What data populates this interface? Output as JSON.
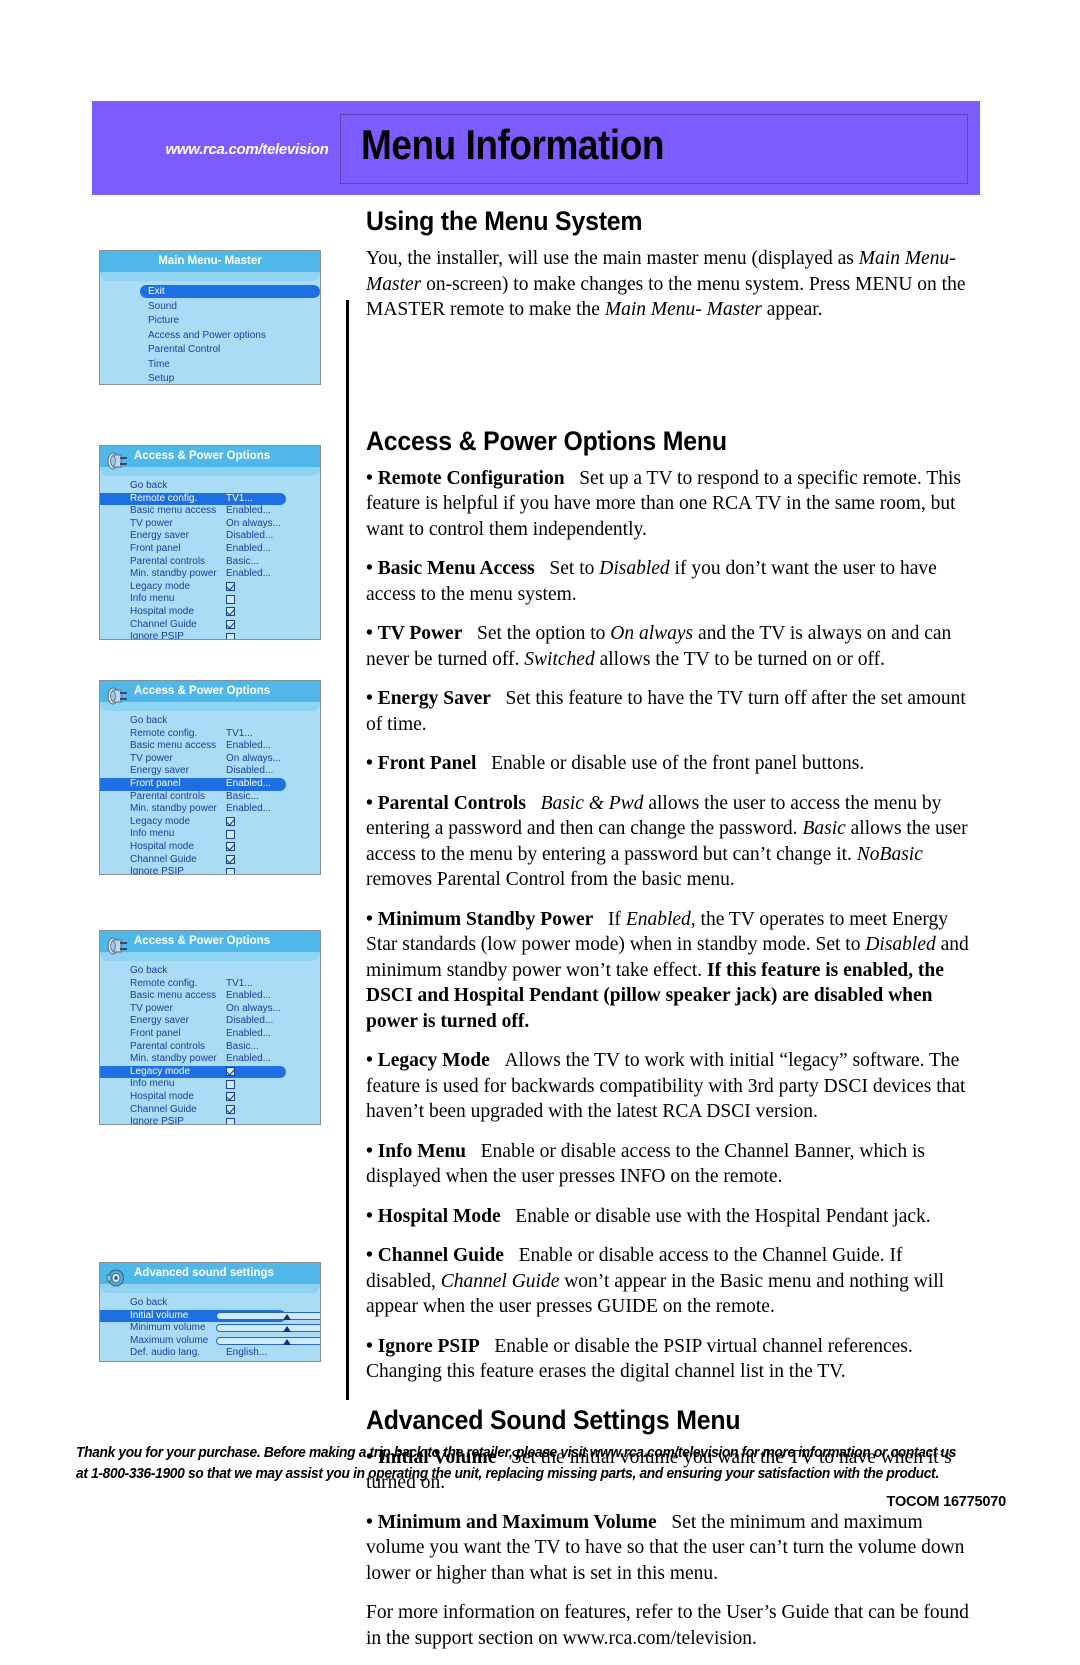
{
  "header": {
    "url": "www.rca.com/television",
    "title": "Menu Information"
  },
  "sections": {
    "using_menu": {
      "heading": "Using the Menu System",
      "p1_a": "You, the installer, will use the main master menu (displayed as ",
      "p1_i1": "Main Menu- Master",
      "p1_b": " on-screen) to make changes to the menu system. Press MENU on the MASTER remote to make the ",
      "p1_i2": "Main Menu- Master",
      "p1_c": " appear."
    },
    "access_power": {
      "heading": "Access & Power Options Menu",
      "b1_lead": "Remote Configuration",
      "b1_text": "Set up a TV to respond to a specific remote. This feature is helpful if you have more than one RCA TV in the same room, but want to control them independently.",
      "b2_lead": "Basic Menu Access",
      "b2_a": "Set to ",
      "b2_i1": "Disabled",
      "b2_b": " if you don’t want the user to have access to the menu system.",
      "b3_lead": "TV Power",
      "b3_a": "Set the option to ",
      "b3_i1": "On always",
      "b3_b": " and the TV is always on and can never be turned off. ",
      "b3_i2": "Switched",
      "b3_c": " allows the TV to be turned on or off.",
      "b4_lead": "Energy Saver",
      "b4_text": "Set this feature to have the TV turn off after the set amount of time.",
      "b5_lead": "Front Panel",
      "b5_text": "Enable or disable use of the front panel buttons.",
      "b6_lead": "Parental Controls",
      "b6_i1": "Basic & Pwd",
      "b6_a": " allows the user to access the menu by entering a password and then can change the password. ",
      "b6_i2": "Basic",
      "b6_b": " allows the user access to the menu by entering a password but can’t change it. ",
      "b6_i3": "NoBasic",
      "b6_c": " removes Parental Control from the basic menu.",
      "b7_lead": "Minimum Standby Power",
      "b7_a": "If ",
      "b7_i1": "Enabled",
      "b7_b": ", the TV operates to meet Energy Star standards (low power mode) when in standby mode. Set to ",
      "b7_i2": "Disabled",
      "b7_c": " and minimum standby power won’t take effect. ",
      "b7_bold": "If this feature is enabled, the DSCI and Hospital Pendant (pillow speaker jack) are disabled when power is turned off.",
      "b8_lead": "Legacy Mode",
      "b8_text": "Allows the TV to work with initial “legacy” software. The feature is used for backwards compatibility with 3rd party DSCI devices that haven’t been upgraded with the latest RCA DSCI version.",
      "b9_lead": "Info Menu",
      "b9_text": "Enable or disable access to the Channel Banner, which is displayed when the user presses INFO on the remote.",
      "b10_lead": "Hospital Mode",
      "b10_text": "Enable or disable use with the Hospital Pendant jack.",
      "b11_lead": "Channel Guide",
      "b11_a": "Enable or disable access to the Channel Guide. If disabled, ",
      "b11_i1": "Channel Guide",
      "b11_b": " won’t appear in the Basic menu and nothing will appear when the user presses GUIDE on the remote.",
      "b12_lead": "Ignore PSIP",
      "b12_text": "Enable or disable the PSIP virtual channel references. Changing this feature erases the digital channel list in the TV."
    },
    "advanced_sound": {
      "heading": "Advanced Sound Settings Menu",
      "b1_lead": "Initial Volume",
      "b1_text": "Set the initial volume you want the TV to have when it’s turned on.",
      "b2_lead": "Minimum and Maximum Volume",
      "b2_text": "Set the minimum and maximum volume you want the TV to have so that the user can’t turn the volume down lower or higher than what is set in this menu.",
      "closing": "For more information on features, refer to the User’s Guide that can be found in the support section on www.rca.com/television."
    }
  },
  "tv_menus": {
    "main": {
      "title": "Main Menu- Master",
      "items": [
        {
          "label": "Exit",
          "value": "",
          "selected": true
        },
        {
          "label": "Sound",
          "value": "",
          "selected": false
        },
        {
          "label": "Picture",
          "value": "",
          "selected": false
        },
        {
          "label": "Access and Power options",
          "value": "",
          "selected": false
        },
        {
          "label": "Parental Control",
          "value": "",
          "selected": false
        },
        {
          "label": "Time",
          "value": "",
          "selected": false
        },
        {
          "label": "Setup",
          "value": "",
          "selected": false
        }
      ]
    },
    "access_1": {
      "title": "Access & Power Options",
      "icon": "power-plug-icon",
      "selected_item": "Remote config.",
      "items": [
        {
          "label": "Go back",
          "value": "",
          "type": "plain"
        },
        {
          "label": "Remote config.",
          "value": "TV1...",
          "type": "value"
        },
        {
          "label": "Basic menu access",
          "value": "Enabled...",
          "type": "value"
        },
        {
          "label": "TV power",
          "value": "On always...",
          "type": "value"
        },
        {
          "label": "Energy saver",
          "value": "Disabled...",
          "type": "value"
        },
        {
          "label": "Front panel",
          "value": "Enabled...",
          "type": "value"
        },
        {
          "label": "Parental controls",
          "value": "Basic...",
          "type": "value"
        },
        {
          "label": "Min. standby power",
          "value": "Enabled...",
          "type": "value"
        },
        {
          "label": "Legacy mode",
          "value": "checked",
          "type": "check"
        },
        {
          "label": "Info menu",
          "value": "unchecked",
          "type": "check"
        },
        {
          "label": "Hospital mode",
          "value": "checked",
          "type": "check"
        },
        {
          "label": "Channel Guide",
          "value": "checked",
          "type": "check"
        },
        {
          "label": "Ignore PSIP",
          "value": "unchecked",
          "type": "check"
        }
      ]
    },
    "access_2": {
      "title": "Access & Power Options",
      "icon": "power-plug-icon",
      "selected_item": "Front panel"
    },
    "access_3": {
      "title": "Access & Power Options",
      "icon": "power-plug-icon",
      "selected_item": "Legacy mode"
    },
    "sound": {
      "title": "Advanced sound settings",
      "icon": "speaker-icon",
      "selected_item": "Initial volume",
      "items": [
        {
          "label": "Go back",
          "value": "",
          "type": "plain"
        },
        {
          "label": "Initial volume",
          "value": "",
          "type": "slider"
        },
        {
          "label": "Minimum volume",
          "value": "",
          "type": "slider"
        },
        {
          "label": "Maximum volume",
          "value": "",
          "type": "slider"
        },
        {
          "label": "Def. audio lang.",
          "value": "English...",
          "type": "value"
        }
      ]
    }
  },
  "footer": {
    "note": "Thank you for your purchase. Before making a trip back to the retailer, please visit www.rca.com/television for more information or contact us at 1-800-336-1900 so that we may assist you in operating the unit, replacing missing parts, and ensuring your satisfaction with the product.",
    "tocom": "TOCOM 16775070"
  }
}
